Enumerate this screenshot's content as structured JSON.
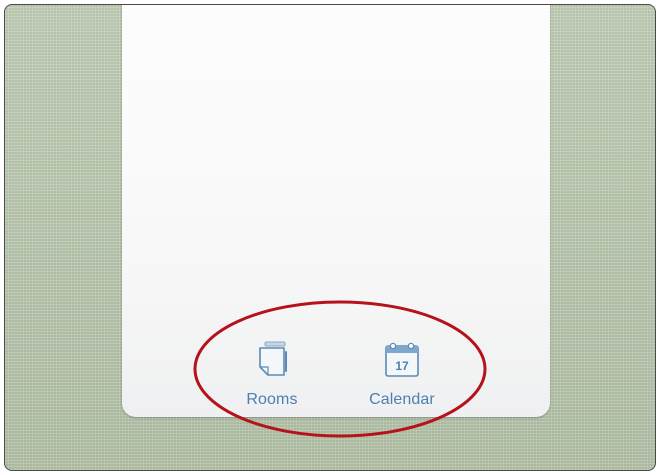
{
  "tabbar": {
    "items": [
      {
        "label": "Rooms",
        "icon": "rooms-icon"
      },
      {
        "label": "Calendar",
        "icon": "calendar-icon",
        "day": "17"
      }
    ]
  },
  "colors": {
    "background": "#bccbb2",
    "panel": "#fdfdfd",
    "tab_label": "#4f7fae",
    "annotation": "#b5121b"
  }
}
